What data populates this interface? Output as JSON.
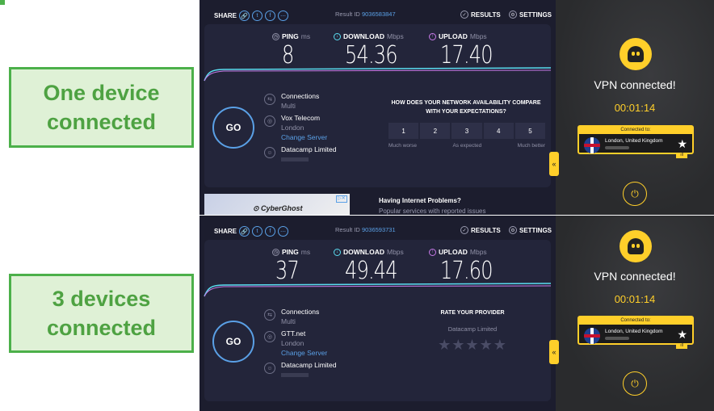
{
  "labels": {
    "top": "One device connected",
    "bottom": "3 devices connected"
  },
  "tests": [
    {
      "share_label": "SHARE",
      "result_prefix": "Result ID",
      "result_id": "9036583847",
      "results_label": "RESULTS",
      "settings_label": "SETTINGS",
      "ping_label": "PING",
      "ping_unit": "ms",
      "ping": "8",
      "download_label": "DOWNLOAD",
      "download_unit": "Mbps",
      "download": "54.36",
      "upload_label": "UPLOAD",
      "upload_unit": "Mbps",
      "upload": "17.40",
      "go_label": "GO",
      "connections_label": "Connections",
      "connections_value": "Multi",
      "isp": "Vox Telecom",
      "location": "London",
      "change_server": "Change Server",
      "server": "Datacamp Limited",
      "question": "HOW DOES YOUR NETWORK AVAILABILITY COMPARE WITH YOUR EXPECTATIONS?",
      "scale": [
        "1",
        "2",
        "3",
        "4",
        "5"
      ],
      "scale_labels": [
        "Much worse",
        "As expected",
        "Much better"
      ],
      "ad_brand": "CyberGhost",
      "ad_title": "Having Internet Problems?",
      "ad_text": "Popular services with reported issues"
    },
    {
      "share_label": "SHARE",
      "result_prefix": "Result ID",
      "result_id": "9036593731",
      "results_label": "RESULTS",
      "settings_label": "SETTINGS",
      "ping_label": "PING",
      "ping_unit": "ms",
      "ping": "37",
      "download_label": "DOWNLOAD",
      "download_unit": "Mbps",
      "download": "49.44",
      "upload_label": "UPLOAD",
      "upload_unit": "Mbps",
      "upload": "17.60",
      "go_label": "GO",
      "connections_label": "Connections",
      "connections_value": "Multi",
      "isp": "GTT.net",
      "location": "London",
      "change_server": "Change Server",
      "server": "Datacamp Limited",
      "rate_title": "RATE YOUR PROVIDER",
      "rate_provider": "Datacamp Limited",
      "stars": "★★★★★"
    }
  ],
  "vpn": [
    {
      "status": "VPN connected!",
      "time": "00:01:14",
      "connected_to": "Connected to:",
      "location": "London, United Kingdom"
    },
    {
      "status": "VPN connected!",
      "time": "00:01:14",
      "connected_to": "Connected to:",
      "location": "London, United Kingdom"
    }
  ],
  "colors": {
    "highlight": "#4cb04a",
    "accent": "#5aa0e6",
    "vpn_yellow": "#ffcf2a"
  }
}
